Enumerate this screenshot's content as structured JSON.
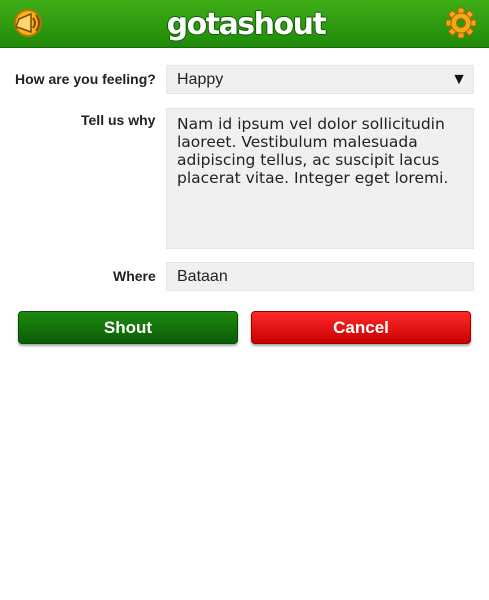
{
  "header": {
    "logo_text": "gotashout",
    "back_icon": "megaphone-back-icon",
    "settings_icon": "gear-icon",
    "bar_color": "#2a9b10"
  },
  "form": {
    "feeling_label": "How are you feeling?",
    "feeling_value": "Happy",
    "reason_label": "Tell us why",
    "reason_value": "Nam id ipsum vel dolor sollicitudin laoreet. Vestibulum malesuada adipiscing tellus, ac suscipit lacus placerat vitae. Integer eget loremi.",
    "where_label": "Where",
    "where_value": "Bataan"
  },
  "actions": {
    "shout_label": "Shout",
    "cancel_label": "Cancel",
    "shout_color": "#138010",
    "cancel_color": "#e80a0a"
  }
}
